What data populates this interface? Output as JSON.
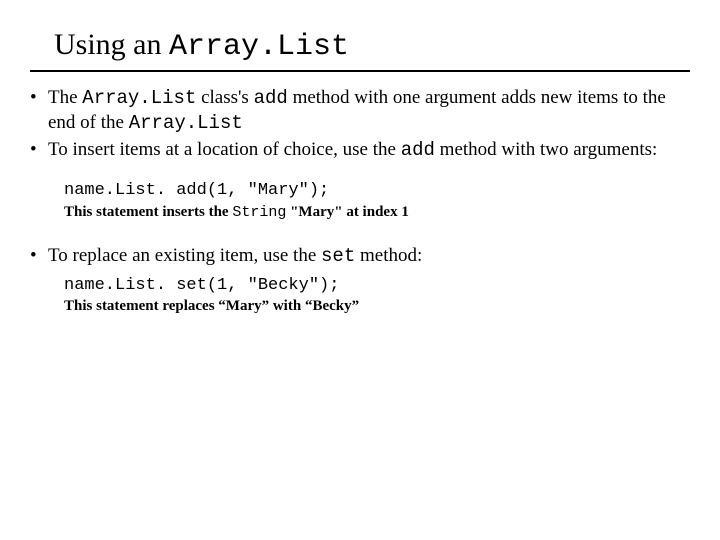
{
  "title": {
    "pre": "Using an ",
    "mono": "Array.List"
  },
  "b1": {
    "pre": "The ",
    "mono1": "Array.List",
    "mid1": " class's ",
    "mono2": "add",
    "mid2": " method with one argument adds new items to the end of the ",
    "mono3": "Array.List"
  },
  "b2": {
    "pre": "To insert items at a location of choice, use the ",
    "mono1": "add",
    "post": " method with two arguments:"
  },
  "code1": {
    "line": "name.List. add(1, \"Mary\");",
    "desc_pre": "This statement inserts the ",
    "desc_mono": "String",
    "desc_post": " \"Mary\" at index 1"
  },
  "b3": {
    "pre": "To replace an existing item, use the ",
    "mono1": "set",
    "post": " method:"
  },
  "code2": {
    "line": "name.List. set(1, \"Becky\");",
    "desc": "This statement replaces “Mary” with “Becky”"
  }
}
